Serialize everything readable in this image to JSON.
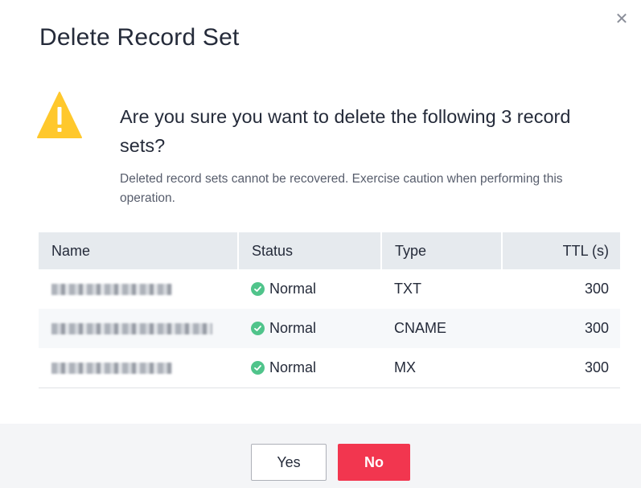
{
  "dialog": {
    "title": "Delete Record Set",
    "close_icon": "close-icon",
    "warning_icon": "warning-triangle-icon",
    "warning_color": "#ffc82c",
    "question": "Are you sure you want to delete the following 3 record sets?",
    "subtext": "Deleted record sets cannot be recovered. Exercise caution when performing this operation."
  },
  "table": {
    "columns": [
      "Name",
      "Status",
      "Type",
      "TTL (s)"
    ],
    "rows": [
      {
        "name": "",
        "status": "Normal",
        "type": "TXT",
        "ttl": "300"
      },
      {
        "name": "",
        "status": "Normal",
        "type": "CNAME",
        "ttl": "300"
      },
      {
        "name": "",
        "status": "Normal",
        "type": "MX",
        "ttl": "300"
      }
    ],
    "status_icon": "check-circle-icon",
    "status_color": "#50c48b"
  },
  "footer": {
    "yes_label": "Yes",
    "no_label": "No",
    "no_color": "#f2364f"
  }
}
